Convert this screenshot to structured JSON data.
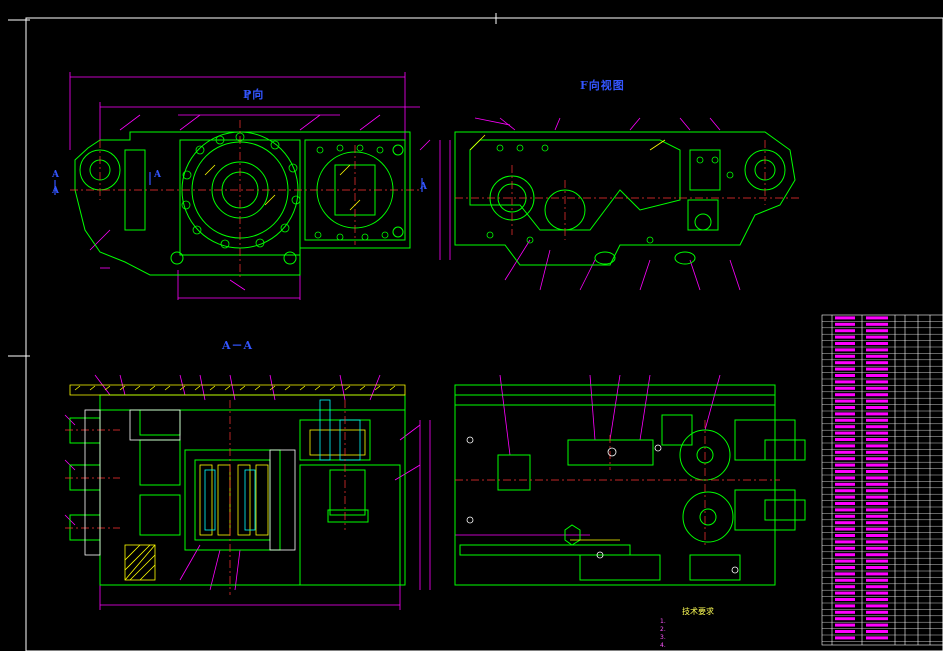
{
  "drawing": {
    "view_top_label": "P向",
    "view_f_label": "F向视图",
    "view_section_label": "A－A",
    "section_marks": [
      "A",
      "A",
      "A",
      "A"
    ],
    "tech_requirements_title": "技术要求",
    "tech_requirements": [
      "1.",
      "2.",
      "3.",
      "4."
    ]
  },
  "colors": {
    "background": "#000000",
    "outline": "#00ff00",
    "dimension": "#ff00ff",
    "centerline": "#ff3333",
    "hatch": "#ffff00",
    "note": "#3355ff",
    "frame": "#ffffff"
  }
}
